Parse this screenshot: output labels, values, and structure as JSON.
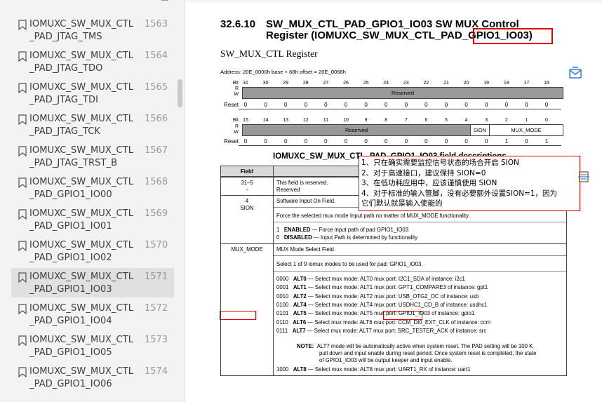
{
  "sidebar": {
    "items": [
      {
        "label1": "IOMUXC_SW_MUX_CTL",
        "label2": "_PAD_JTAG_TMS",
        "page": "1563"
      },
      {
        "label1": "IOMUXC_SW_MUX_CTL",
        "label2": "_PAD_JTAG_TDO",
        "page": "1564"
      },
      {
        "label1": "IOMUXC_SW_MUX_CTL",
        "label2": "_PAD_JTAG_TDI",
        "page": "1565"
      },
      {
        "label1": "IOMUXC_SW_MUX_CTL",
        "label2": "_PAD_JTAG_TCK",
        "page": "1566"
      },
      {
        "label1": "IOMUXC_SW_MUX_CTL",
        "label2": "_PAD_JTAG_TRST_B",
        "page": "1567"
      },
      {
        "label1": "IOMUXC_SW_MUX_CTL",
        "label2": "_PAD_GPIO1_IO00",
        "page": "1568"
      },
      {
        "label1": "IOMUXC_SW_MUX_CTL",
        "label2": "_PAD_GPIO1_IO01",
        "page": "1569"
      },
      {
        "label1": "IOMUXC_SW_MUX_CTL",
        "label2": "_PAD_GPIO1_IO02",
        "page": "1570"
      },
      {
        "label1": "IOMUXC_SW_MUX_CTL",
        "label2": "_PAD_GPIO1_IO03",
        "page": "1571",
        "active": true
      },
      {
        "label1": "IOMUXC_SW_MUX_CTL",
        "label2": "_PAD_GPIO1_IO04",
        "page": "1572"
      },
      {
        "label1": "IOMUXC_SW_MUX_CTL",
        "label2": "_PAD_GPIO1_IO05",
        "page": "1573"
      },
      {
        "label1": "IOMUXC_SW_MUX_CTL",
        "label2": "_PAD_GPIO1_IO06",
        "page": "1574"
      }
    ],
    "icon": "bookmark-icon"
  },
  "doc": {
    "section_number": "32.6.10",
    "title_line1": "SW_MUX_CTL_PAD_GPIO1_IO03 SW MUX Control",
    "title_line2_prefix": "Register (IOMUXC_SW_MUX_CTL_PAD",
    "title_line2_highlight": "_GPIO1_IO03)",
    "subtitle": "SW_MUX_CTL Register",
    "address": "Address: 20E_0000h base + 68h offset = 20E_0068h",
    "reg_upper": {
      "bit_label": "Bit",
      "bits": [
        "31",
        "30",
        "29",
        "28",
        "27",
        "26",
        "25",
        "24",
        "23",
        "22",
        "21",
        "20",
        "19",
        "18",
        "17",
        "16"
      ],
      "r_label": "R",
      "w_label": "W",
      "field": "Reserved",
      "reset_label": "Reset",
      "reset": [
        "0",
        "0",
        "0",
        "0",
        "0",
        "0",
        "0",
        "0",
        "0",
        "0",
        "0",
        "0",
        "0",
        "0",
        "0",
        "0"
      ]
    },
    "reg_lower": {
      "bit_label": "Bit",
      "bits": [
        "15",
        "14",
        "13",
        "12",
        "11",
        "10",
        "9",
        "8",
        "7",
        "6",
        "5",
        "4",
        "3",
        "2",
        "1",
        "0"
      ],
      "r_label": "R",
      "w_label": "W",
      "field_reserved": "Reserved",
      "field_sion": "SION",
      "field_mux": "MUX_MODE",
      "reset_label": "Reset",
      "reset": [
        "0",
        "0",
        "0",
        "0",
        "0",
        "0",
        "0",
        "0",
        "0",
        "0",
        "0",
        "0",
        "0",
        "1",
        "0",
        "1"
      ]
    },
    "field_desc_title": "IOMUXC_SW_MUX_CTL_PAD_GPIO1_IO03 field descriptions",
    "table": {
      "hdr_field": "Field",
      "r1_field": "31–5",
      "r1_field2": "-",
      "r1_desc1": "This field is reserved.",
      "r1_desc2": "Reserved",
      "r2_field": "4",
      "r2_field2": "SION",
      "r2_desc1": "Software Input On Field.",
      "r2_desc2": "Force the selected mux mode Input path no matter of MUX_MODE functionality.",
      "r2_opt1_code": "1",
      "r2_opt1_name": "ENABLED",
      "r2_opt1_desc": " — Force input path of pad GPIO1_IO03",
      "r2_opt0_code": "0",
      "r2_opt0_name": "DISABLED",
      "r2_opt0_desc": " — Input Path is determined by functionality",
      "r3_field": "MUX_MODE",
      "r3_desc1": "MUX Mode Select Field.",
      "r3_desc2": "Select 1 of 9 iomux modes to be used for pad: GPIO1_IO03.",
      "modes": [
        {
          "code": "0000",
          "name": "ALT0",
          "desc": " — Select mux mode: ALT0 mux port: I2C1_SDA of instance: i2c1"
        },
        {
          "code": "0001",
          "name": "ALT1",
          "desc": " — Select mux mode: ALT1 mux port: GPT1_COMPARE3 of instance: gpt1"
        },
        {
          "code": "0010",
          "name": "ALT2",
          "desc": " — Select mux mode: ALT2 mux port: USB_OTG2_OC of instance: usb"
        },
        {
          "code": "0100",
          "name": "ALT4",
          "desc": " — Select mux mode: ALT4 mux port: USDHC1_CD_B of instance: usdhc1"
        },
        {
          "code": "0101",
          "name": "ALT5",
          "desc_pre": " — Select mux mode: ALT5 mux port: ",
          "desc_hl": "GPIO1_IO03",
          "desc_post": " of instance: gpio1"
        },
        {
          "code": "0110",
          "name": "ALT6",
          "desc": " — Select mux mode: ALT6 mux port: CCM_DI0_EXT_CLK of instance: ccm"
        },
        {
          "code": "0111",
          "name": "ALT7",
          "desc": " — Select mux mode: ALT7 mux port: SRC_TESTER_ACK of instance: src"
        }
      ],
      "note_label": "NOTE:",
      "note1": "ALT7 mode will be automatically active when system reset. The PAD setting will be 100 K",
      "note2": "pull down and input enable during reset period. Once system reset is completed, the state",
      "note3": "of GPIO1_IO03 will be output keeper and input enable.",
      "mode8": {
        "code": "1000",
        "name": "ALT8",
        "desc": " — Select mux mode: ALT8 mux port: UART1_RX of instance: uart1"
      }
    },
    "annotation": [
      "1、只在确实需要监控信号状态的场合开启 SION",
      "2、对于高速接口，建议保持 SION=0",
      "3、在低功耗应用中，应该谨慎使用 SION",
      "4、对于标准的输入管脚，没有必要额外设置SION=1，因为",
      "它们默认就是输入使能的"
    ]
  },
  "floating": {
    "top_icon": "mail-share-icon",
    "mid_icon": "document-scan-icon"
  }
}
